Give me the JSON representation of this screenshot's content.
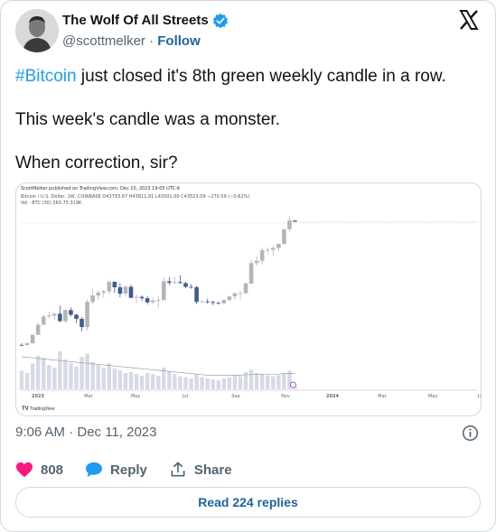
{
  "author": {
    "name": "The Wolf Of All Streets",
    "handle": "@scottmelker",
    "separator": "·",
    "follow_label": "Follow",
    "verified_color": "#1d9bf0"
  },
  "tweet": {
    "hashtag": "#Bitcoin",
    "line1_rest": " just closed it's 8th green weekly candle in a row.",
    "line2": "This week's candle was a monster.",
    "line3": "When correction, sir?"
  },
  "chart_meta": {
    "published": "ScottMelker published on TradingView.com, Dec 10, 2023 19:05 UTC-6",
    "symbol": "Bitcoin / U.S. Dollar, 1W, COINBASE",
    "ohlc": "O43793.67  H43811.81  L43501.00  C43523.09  −270.59 (−0.62%)",
    "vol": "Vol · BTC (30)  260  75.319K",
    "footer": "TradingView"
  },
  "chart_data": {
    "type": "candlestick",
    "x_tick_labels": [
      "2023",
      "Mar",
      "May",
      "Jul",
      "Sep",
      "Nov",
      "2024",
      "Mar",
      "May",
      "Jul"
    ],
    "candles": [
      {
        "o": 16600,
        "h": 17000,
        "l": 16300,
        "c": 16550
      },
      {
        "o": 16550,
        "h": 17100,
        "l": 16500,
        "c": 16950
      },
      {
        "o": 16950,
        "h": 19000,
        "l": 16900,
        "c": 18800
      },
      {
        "o": 18800,
        "h": 21400,
        "l": 18700,
        "c": 21000
      },
      {
        "o": 21000,
        "h": 23300,
        "l": 20900,
        "c": 22800
      },
      {
        "o": 22800,
        "h": 23900,
        "l": 22300,
        "c": 23000
      },
      {
        "o": 23000,
        "h": 23500,
        "l": 22000,
        "c": 23400
      },
      {
        "o": 23400,
        "h": 25200,
        "l": 21500,
        "c": 21800
      },
      {
        "o": 21800,
        "h": 24400,
        "l": 21400,
        "c": 24200
      },
      {
        "o": 24200,
        "h": 24800,
        "l": 22800,
        "c": 23200
      },
      {
        "o": 23200,
        "h": 23400,
        "l": 21400,
        "c": 22300
      },
      {
        "o": 22300,
        "h": 22700,
        "l": 19600,
        "c": 20500
      },
      {
        "o": 20500,
        "h": 26600,
        "l": 19700,
        "c": 26000
      },
      {
        "o": 26000,
        "h": 28800,
        "l": 25500,
        "c": 27400
      },
      {
        "o": 27400,
        "h": 28500,
        "l": 26500,
        "c": 28000
      },
      {
        "o": 28000,
        "h": 28600,
        "l": 27000,
        "c": 28300
      },
      {
        "o": 28300,
        "h": 30900,
        "l": 27700,
        "c": 30400
      },
      {
        "o": 30400,
        "h": 30500,
        "l": 28000,
        "c": 29200
      },
      {
        "o": 29200,
        "h": 30100,
        "l": 27000,
        "c": 27800
      },
      {
        "o": 27800,
        "h": 29700,
        "l": 27200,
        "c": 29300
      },
      {
        "o": 29300,
        "h": 29800,
        "l": 26800,
        "c": 26900
      },
      {
        "o": 26900,
        "h": 27600,
        "l": 25800,
        "c": 27100
      },
      {
        "o": 27100,
        "h": 27400,
        "l": 26200,
        "c": 26800
      },
      {
        "o": 26800,
        "h": 27300,
        "l": 25400,
        "c": 25900
      },
      {
        "o": 25900,
        "h": 26900,
        "l": 25500,
        "c": 26300
      },
      {
        "o": 26300,
        "h": 27200,
        "l": 24800,
        "c": 26400
      },
      {
        "o": 26400,
        "h": 31300,
        "l": 26200,
        "c": 30500
      },
      {
        "o": 30500,
        "h": 31400,
        "l": 29600,
        "c": 30200
      },
      {
        "o": 30200,
        "h": 31500,
        "l": 29900,
        "c": 30300
      },
      {
        "o": 30300,
        "h": 31800,
        "l": 30000,
        "c": 30100
      },
      {
        "o": 30100,
        "h": 30400,
        "l": 29000,
        "c": 29300
      },
      {
        "o": 29300,
        "h": 29900,
        "l": 28900,
        "c": 29200
      },
      {
        "o": 29200,
        "h": 29500,
        "l": 25500,
        "c": 26000
      },
      {
        "o": 26000,
        "h": 26300,
        "l": 25800,
        "c": 26100
      },
      {
        "o": 26100,
        "h": 26700,
        "l": 25600,
        "c": 26000
      },
      {
        "o": 26000,
        "h": 26200,
        "l": 25300,
        "c": 25800
      },
      {
        "o": 25800,
        "h": 26000,
        "l": 25400,
        "c": 25700
      },
      {
        "o": 25700,
        "h": 26500,
        "l": 25500,
        "c": 26400
      },
      {
        "o": 26400,
        "h": 27400,
        "l": 26200,
        "c": 27200
      },
      {
        "o": 27200,
        "h": 28100,
        "l": 26500,
        "c": 27900
      },
      {
        "o": 27900,
        "h": 28500,
        "l": 26600,
        "c": 27900
      },
      {
        "o": 27900,
        "h": 30300,
        "l": 27800,
        "c": 30000
      },
      {
        "o": 30000,
        "h": 35200,
        "l": 29900,
        "c": 34500
      },
      {
        "o": 34500,
        "h": 35900,
        "l": 33900,
        "c": 35000
      },
      {
        "o": 35000,
        "h": 37900,
        "l": 34200,
        "c": 37300
      },
      {
        "o": 37300,
        "h": 37900,
        "l": 36400,
        "c": 37400
      },
      {
        "o": 37400,
        "h": 38400,
        "l": 36100,
        "c": 37800
      },
      {
        "o": 37800,
        "h": 38400,
        "l": 37000,
        "c": 38700
      },
      {
        "o": 38700,
        "h": 42000,
        "l": 38500,
        "c": 41900
      },
      {
        "o": 41900,
        "h": 44700,
        "l": 41300,
        "c": 43790
      },
      {
        "o": 43793.67,
        "h": 43811.81,
        "l": 43501,
        "c": 43523.09
      }
    ],
    "volumes": [
      34,
      30,
      48,
      62,
      58,
      45,
      40,
      70,
      55,
      48,
      42,
      60,
      66,
      50,
      45,
      40,
      48,
      38,
      35,
      30,
      32,
      28,
      25,
      30,
      28,
      25,
      40,
      34,
      28,
      24,
      22,
      20,
      28,
      22,
      20,
      18,
      17,
      20,
      22,
      26,
      24,
      32,
      36,
      30,
      28,
      26,
      24,
      26,
      30,
      34,
      4
    ],
    "volume_ma": [
      60,
      59,
      58,
      57,
      56,
      55,
      54,
      53,
      52,
      51,
      50,
      49,
      48,
      47,
      46,
      45,
      44,
      43,
      42,
      41,
      40,
      39,
      38,
      37,
      36,
      35,
      34,
      33,
      32,
      31,
      30,
      29,
      28,
      27,
      26,
      26,
      26,
      26,
      26,
      26,
      26,
      27,
      27,
      28,
      28,
      28,
      28,
      28,
      29,
      29,
      29
    ],
    "up_color": "#b5b5b5",
    "down_color": "#42598f"
  },
  "meta": {
    "timestamp": "9:06 AM · Dec 11, 2023"
  },
  "actions": {
    "like_count": "808",
    "reply_label": "Reply",
    "share_label": "Share",
    "like_color": "#f91880",
    "reply_color": "#1d9bf0"
  },
  "read_replies_label": "Read 224 replies"
}
